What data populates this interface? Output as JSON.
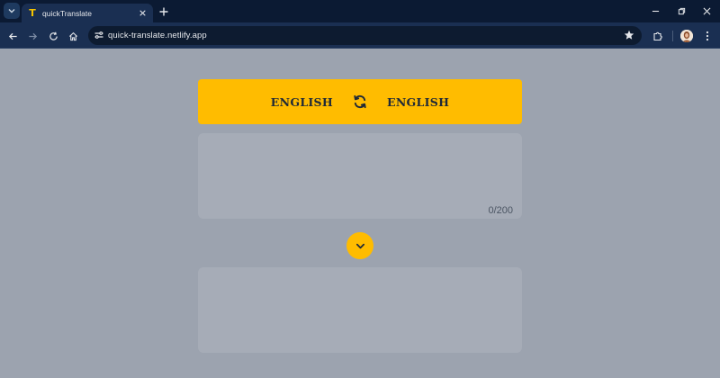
{
  "browser": {
    "tab": {
      "title": "quickTranslate",
      "favicon_letter": "T",
      "favicon_color": "#f5c400"
    },
    "url": "quick-translate.netlify.app",
    "icons": [
      "tab-search-icon",
      "close-icon",
      "plus-icon",
      "minimize-icon",
      "restore-icon",
      "close-window-icon",
      "back-arrow-icon",
      "forward-arrow-icon",
      "reload-icon",
      "home-icon",
      "site-info-icon",
      "star-icon",
      "extensions-icon",
      "profile-avatar",
      "kebab-menu-icon"
    ]
  },
  "app": {
    "source_language": "ENGLISH",
    "target_language": "ENGLISH",
    "swap_icon": "swap-icon",
    "input": {
      "value": "",
      "placeholder": "",
      "counter": "0/200"
    },
    "translate_icon": "chevron-down-icon",
    "output": {
      "text": ""
    },
    "colors": {
      "accent": "#ffbc00",
      "background": "#9ca3af",
      "panel": "#a6acb7",
      "text": "#1f2937"
    }
  }
}
